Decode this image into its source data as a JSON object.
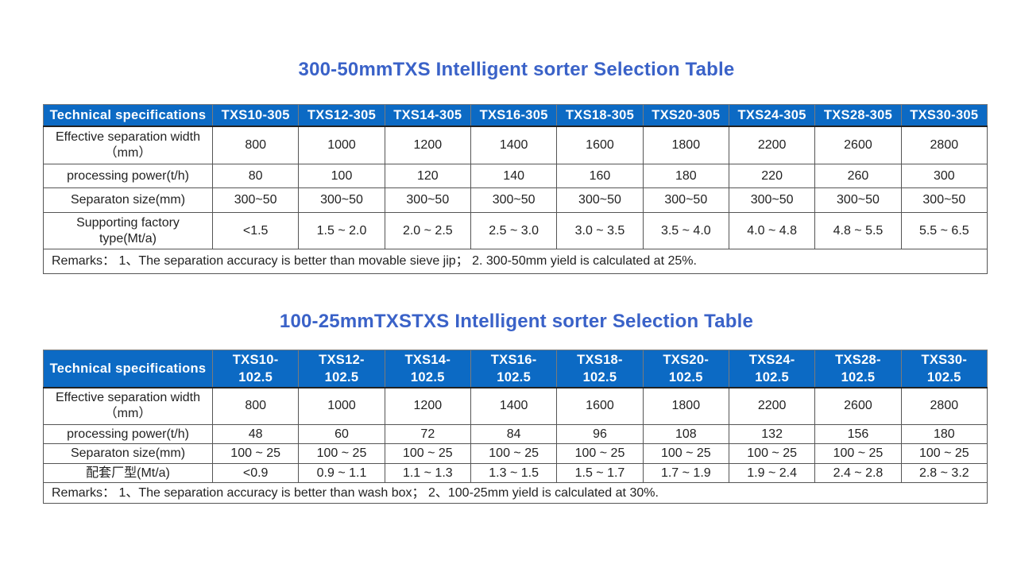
{
  "tables": [
    {
      "title": "300-50mmTXS Intelligent sorter Selection Table",
      "header_label": "Technical specifications",
      "models": [
        "TXS10-305",
        "TXS12-305",
        "TXS14-305",
        "TXS16-305",
        "TXS18-305",
        "TXS20-305",
        "TXS24-305",
        "TXS28-305",
        "TXS30-305"
      ],
      "rows": [
        {
          "label": "Effective separation width\n（mm）",
          "values": [
            "800",
            "1000",
            "1200",
            "1400",
            "1600",
            "1800",
            "2200",
            "2600",
            "2800"
          ]
        },
        {
          "label": "processing power(t/h)",
          "values": [
            "80",
            "100",
            "120",
            "140",
            "160",
            "180",
            "220",
            "260",
            "300"
          ]
        },
        {
          "label": "Separaton size(mm)",
          "values": [
            "300~50",
            "300~50",
            "300~50",
            "300~50",
            "300~50",
            "300~50",
            "300~50",
            "300~50",
            "300~50"
          ]
        },
        {
          "label": "Supporting factory\ntype(Mt/a)",
          "values": [
            "<1.5",
            "1.5 ~ 2.0",
            "2.0 ~ 2.5",
            "2.5 ~ 3.0",
            "3.0 ~ 3.5",
            "3.5 ~ 4.0",
            "4.0 ~ 4.8",
            "4.8 ~ 5.5",
            "5.5 ~ 6.5"
          ]
        }
      ],
      "remarks": "Remarks：  1、The separation accuracy is better than movable sieve jip；  2. 300-50mm yield is calculated at 25%."
    },
    {
      "title": "100-25mmTXSTXS Intelligent sorter Selection Table",
      "header_label": "Technical specifications",
      "models": [
        "TXS10-\n102.5",
        "TXS12-\n102.5",
        "TXS14-\n102.5",
        "TXS16-\n102.5",
        "TXS18-\n102.5",
        "TXS20-\n102.5",
        "TXS24-\n102.5",
        "TXS28-\n102.5",
        "TXS30-\n102.5"
      ],
      "rows": [
        {
          "label": "Effective separation width\n（mm）",
          "values": [
            "800",
            "1000",
            "1200",
            "1400",
            "1600",
            "1800",
            "2200",
            "2600",
            "2800"
          ]
        },
        {
          "label": "processing power(t/h)",
          "values": [
            "48",
            "60",
            "72",
            "84",
            "96",
            "108",
            "132",
            "156",
            "180"
          ]
        },
        {
          "label": "Separaton size(mm)",
          "values": [
            "100 ~ 25",
            "100 ~ 25",
            "100 ~ 25",
            "100 ~ 25",
            "100 ~ 25",
            "100 ~ 25",
            "100 ~ 25",
            "100 ~ 25",
            "100 ~ 25"
          ]
        },
        {
          "label": "配套厂型(Mt/a)",
          "values": [
            "<0.9",
            "0.9 ~ 1.1",
            "1.1 ~ 1.3",
            "1.3 ~ 1.5",
            "1.5 ~ 1.7",
            "1.7 ~ 1.9",
            "1.9 ~ 2.4",
            "2.4 ~ 2.8",
            "2.8 ~ 3.2"
          ]
        }
      ],
      "remarks": "Remarks：  1、The separation accuracy is better than wash box；  2、100-25mm yield is calculated at 30%."
    }
  ],
  "colors": {
    "title": "#3a62c8",
    "header_bg": "#0c6ac4",
    "header_text": "#ffffff"
  }
}
